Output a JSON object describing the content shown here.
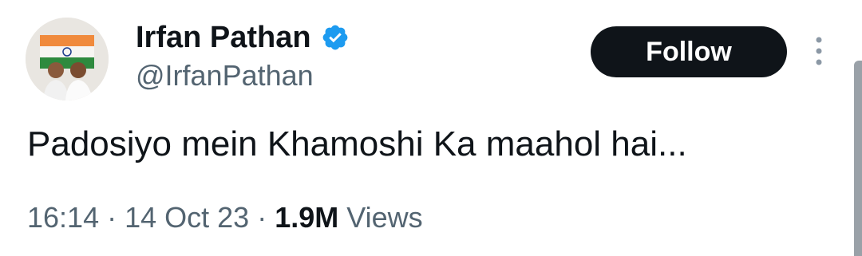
{
  "tweet": {
    "author": {
      "display_name": "Irfan Pathan",
      "handle": "@IrfanPathan",
      "verified": true,
      "avatar_icon": "profile-photo-with-indian-flag",
      "verified_icon": "verified-badge-icon"
    },
    "follow_label": "Follow",
    "more_icon": "vertical-ellipsis-icon",
    "text": "Padosiyo mein Khamoshi Ka maahol hai...",
    "time": "16:14",
    "date": "14 Oct 23",
    "separator": "·",
    "views_count": "1.9M",
    "views_label": "Views"
  },
  "colors": {
    "accent_verified": "#1d9bf0",
    "button_bg": "#0f1419",
    "button_text": "#ffffff",
    "secondary_text": "#536471",
    "primary_text": "#0f1419"
  }
}
